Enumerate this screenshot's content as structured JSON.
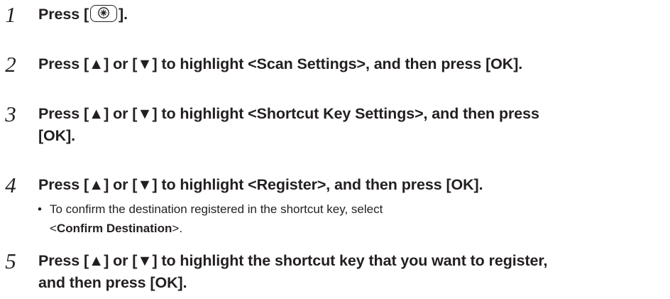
{
  "steps": [
    {
      "number": "1",
      "text_before": "Press [",
      "icon": "settings-menu-key-icon",
      "text_after": "]."
    },
    {
      "number": "2",
      "text": "Press [▲] or [▼] to highlight <Scan Settings>, and then press [OK]."
    },
    {
      "number": "3",
      "line1": "Press [▲] or [▼] to highlight <Shortcut Key Settings>, and then press",
      "line2": "[OK]."
    },
    {
      "number": "4",
      "text": "Press [▲] or [▼] to highlight <Register>, and then press [OK].",
      "note": {
        "bullet": "•",
        "line1": "To confirm the destination registered in the shortcut key, select",
        "open": "<",
        "bold": "Confirm Destination",
        "close": ">."
      }
    },
    {
      "number": "5",
      "line1": "Press [▲] or [▼] to highlight the shortcut key that you want to register,",
      "line2": "and then press [OK]."
    }
  ]
}
